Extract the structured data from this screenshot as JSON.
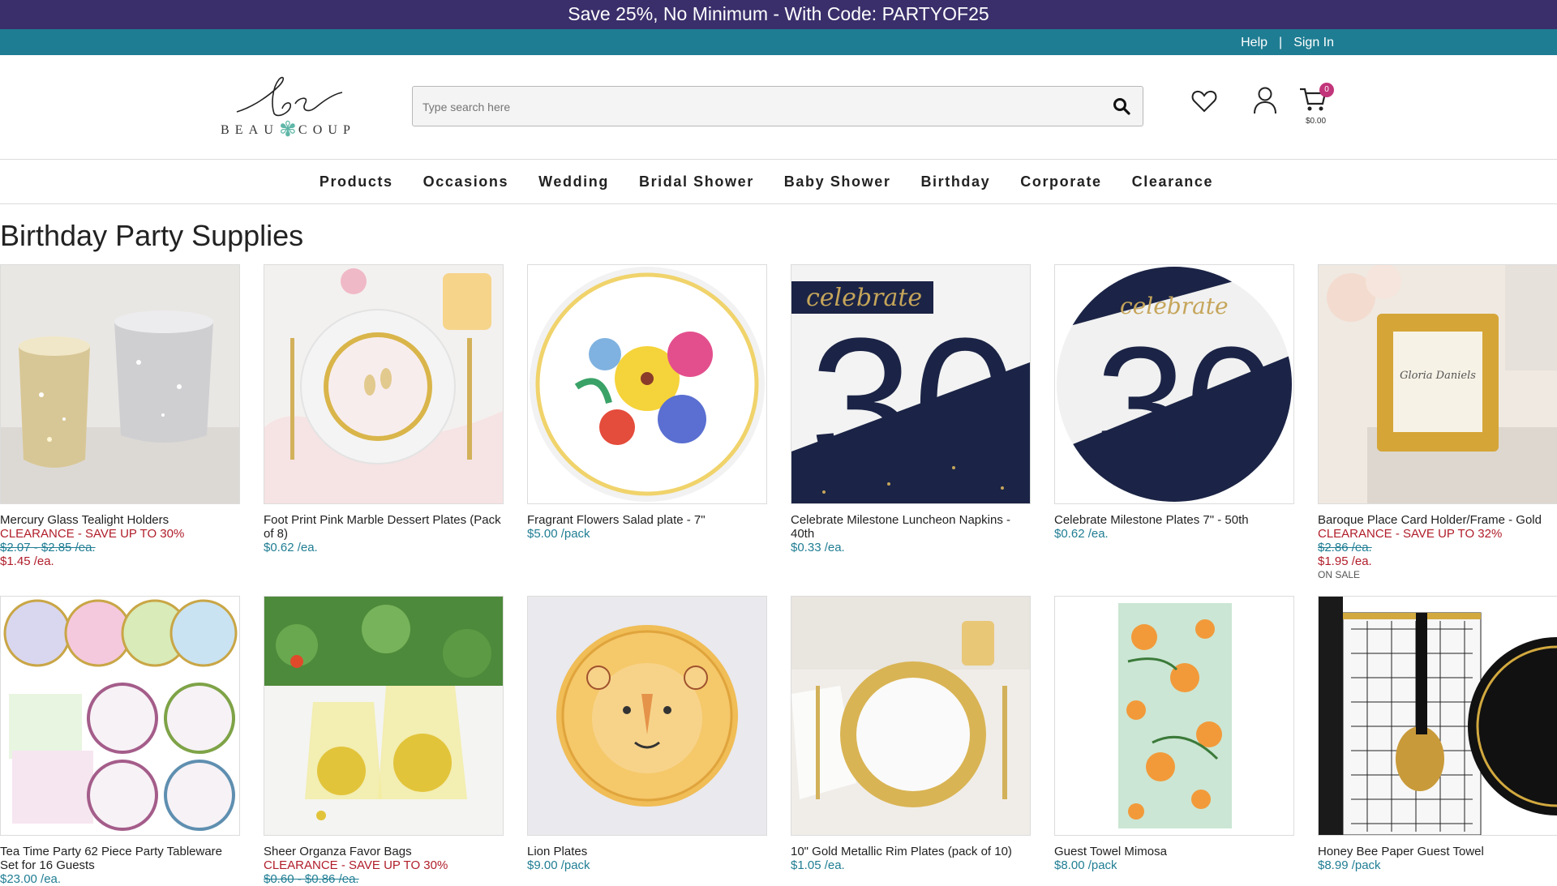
{
  "promo": "Save 25%, No Minimum - With Code: PARTYOF25",
  "utility": {
    "help": "Help",
    "sep": "|",
    "sign_in": "Sign In"
  },
  "logo": {
    "letters": [
      "B",
      "E",
      "A",
      "U",
      "",
      "C",
      "O",
      "U",
      "P"
    ],
    "script": "bc"
  },
  "search": {
    "placeholder": "Type search here"
  },
  "cart": {
    "count": "0",
    "total": "$0.00"
  },
  "nav": [
    "Products",
    "Occasions",
    "Wedding",
    "Bridal Shower",
    "Baby Shower",
    "Birthday",
    "Corporate",
    "Clearance"
  ],
  "page_title": "Birthday Party Supplies",
  "products": [
    {
      "name": "Mercury Glass Tealight Holders",
      "clearance": "CLEARANCE - SAVE UP TO 30%",
      "orig": "$2.07 - $2.85 /ea.",
      "sale": "$1.45 /ea.",
      "price": "",
      "onsale": ""
    },
    {
      "name": "Foot Print Pink Marble Dessert Plates (Pack of 8)",
      "clearance": "",
      "orig": "",
      "sale": "",
      "price": "$0.62 /ea.",
      "onsale": ""
    },
    {
      "name": "Fragrant Flowers Salad plate - 7\"",
      "clearance": "",
      "orig": "",
      "sale": "",
      "price": "$5.00 /pack",
      "onsale": ""
    },
    {
      "name": "Celebrate Milestone Luncheon Napkins - 40th",
      "clearance": "",
      "orig": "",
      "sale": "",
      "price": "$0.33 /ea.",
      "onsale": ""
    },
    {
      "name": "Celebrate Milestone Plates 7\" - 50th",
      "clearance": "",
      "orig": "",
      "sale": "",
      "price": "$0.62 /ea.",
      "onsale": ""
    },
    {
      "name": "Baroque Place Card Holder/Frame - Gold",
      "clearance": "CLEARANCE - SAVE UP TO 32%",
      "orig": "$2.86 /ea.",
      "sale": "$1.95 /ea.",
      "price": "",
      "onsale": "ON SALE"
    },
    {
      "name": "Tea Time Party 62 Piece Party Tableware Set for 16 Guests",
      "clearance": "",
      "orig": "",
      "sale": "",
      "price": "$23.00 /ea.",
      "onsale": ""
    },
    {
      "name": "Sheer Organza Favor Bags",
      "clearance": "CLEARANCE - SAVE UP TO 30%",
      "orig": "$0.60 - $0.86 /ea.",
      "sale": "",
      "price": "",
      "onsale": ""
    },
    {
      "name": "Lion Plates",
      "clearance": "",
      "orig": "",
      "sale": "",
      "price": "$9.00 /pack",
      "onsale": ""
    },
    {
      "name": "10\" Gold Metallic Rim Plates (pack of 10)",
      "clearance": "",
      "orig": "",
      "sale": "",
      "price": "$1.05 /ea.",
      "onsale": ""
    },
    {
      "name": "Guest Towel Mimosa",
      "clearance": "",
      "orig": "",
      "sale": "",
      "price": "$8.00 /pack",
      "onsale": ""
    },
    {
      "name": "Honey Bee Paper Guest Towel",
      "clearance": "",
      "orig": "",
      "sale": "",
      "price": "$8.99 /pack",
      "onsale": ""
    }
  ],
  "image_text": {
    "celebrate": "celebrate",
    "thirty": "30",
    "card_name": "Gloria Daniels"
  },
  "colors": {
    "promo_bg": "#3a2f6b",
    "utility_bg": "#1f7d93",
    "price": "#1f7d93",
    "clearance": "#b01d2a",
    "badge": "#c2357a"
  }
}
